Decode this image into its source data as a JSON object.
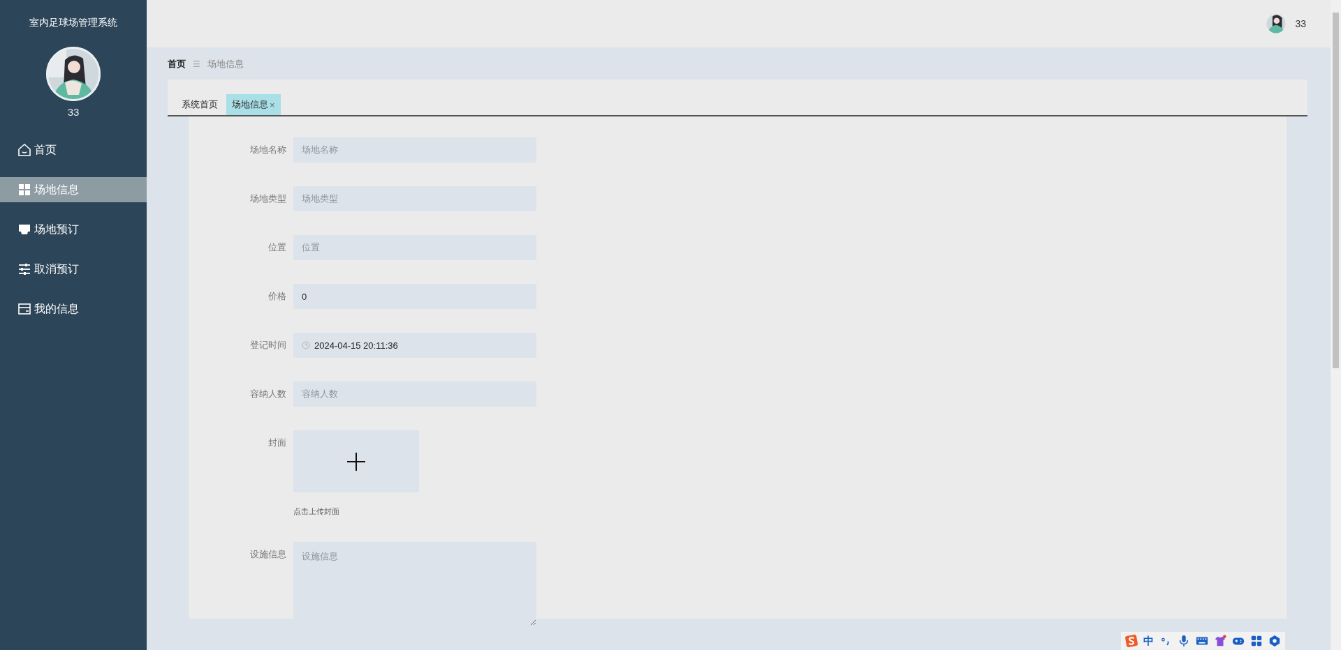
{
  "sidebar": {
    "title": "室内足球场管理系统",
    "user": {
      "name": "33"
    },
    "items": [
      {
        "label": "首页",
        "selected": false
      },
      {
        "label": "场地信息",
        "selected": true
      },
      {
        "label": "场地预订",
        "selected": false
      },
      {
        "label": "取消预订",
        "selected": false
      },
      {
        "label": "我的信息",
        "selected": false
      }
    ]
  },
  "header": {
    "user": {
      "name": "33"
    }
  },
  "breadcrumb": {
    "home": "首页",
    "separator": "☰",
    "current": "场地信息"
  },
  "tabs": [
    {
      "label": "系统首页",
      "selected": false,
      "closable": false
    },
    {
      "label": "场地信息",
      "selected": true,
      "closable": true,
      "close": "×"
    }
  ],
  "form": {
    "fields": [
      {
        "kind": "text",
        "label": "场地名称",
        "placeholder": "场地名称"
      },
      {
        "kind": "text",
        "label": "场地类型",
        "placeholder": "场地类型"
      },
      {
        "kind": "text",
        "label": "位置",
        "placeholder": "位置"
      },
      {
        "kind": "text",
        "label": "价格",
        "value": "0"
      },
      {
        "kind": "datetime",
        "label": "登记时间",
        "value": "2024-04-15 20:11:36"
      },
      {
        "kind": "text",
        "label": "容纳人数",
        "placeholder": "容纳人数"
      },
      {
        "kind": "upload",
        "label": "封面",
        "hint": "点击上传封面"
      },
      {
        "kind": "textarea",
        "label": "设施信息",
        "placeholder": "设施信息"
      }
    ]
  },
  "ime_bar": {
    "mode": "中"
  }
}
